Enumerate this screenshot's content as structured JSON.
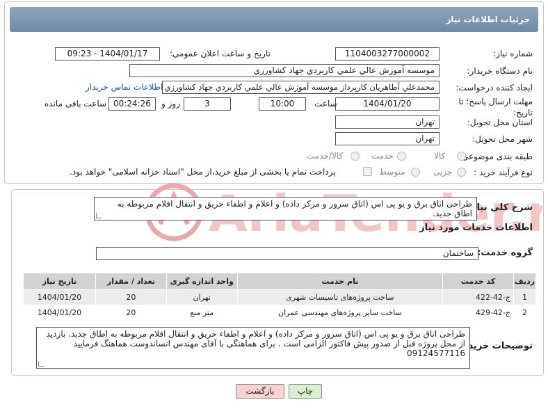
{
  "header": {
    "title": "جزئیات اطلاعات نیاز"
  },
  "fields": {
    "need_number_label": "شماره نیاز:",
    "need_number": "1104003277000002",
    "announce_label": "تاریخ و ساعت اعلان عمومی:",
    "announce_value": "1404/01/17 - 09:23",
    "buyer_org_label": "نام دستگاه خریدار:",
    "buyer_org": "موسسه آموزش عالي علمي کاربردي جهاد کشاورزي",
    "creator_label": "ایجاد کننده درخواست:",
    "creator": "محمدعلي آطاهريان کارپرداز موسسه آموزش عالي علمي کاربردي جهاد کشاورزي",
    "contact_link": "اطلاعات تماس خریدار",
    "deadline_label": "مهلت ارسال پاسخ: تا تاریخ:",
    "deadline_date": "1404/01/20",
    "time_label": "ساعت",
    "deadline_time": "10:00",
    "days_value": "3",
    "days_label": "روز و",
    "remaining_time": "00:24:26",
    "remaining_label": "ساعت باقی مانده",
    "province_label": "استان محل تحویل:",
    "province": "تهران",
    "city_label": "شهر محل تحویل:",
    "city": "تهران",
    "category_label": "طبقه بندی موضوعی:",
    "category_options": [
      "کالا",
      "خدمت",
      "کالا/خدمت"
    ],
    "process_label": "نوع فرآیند خرید :",
    "process_options": [
      "جزیی",
      "متوسط"
    ],
    "payment_note": "پرداخت تمام یا بخشی از مبلغ خرید،از محل \"اسناد خزانه اسلامی\" خواهد بود."
  },
  "summary": {
    "label": "شرح کلی نیاز:",
    "text": "طراحی اتاق برق و یو پی اس (اتاق سرور و مرکز داده) و اعلام و اطفاء حریق و انتقال اقلام مربوطه به اطاق جدید."
  },
  "services": {
    "title": "اطلاعات خدمات مورد نیاز",
    "group_label": "گروه خدمت:",
    "group_value": "ساختمان",
    "columns": [
      "ردیف",
      "کد خدمت",
      "نام خدمت",
      "واحد اندازه گیری",
      "تعداد / مقدار",
      "تاریخ نیاز"
    ],
    "rows": [
      {
        "idx": "1",
        "code": "ج-42-422",
        "name": "ساخت پروژه‌های تاسیسات شهری",
        "unit": "تهران",
        "qty": "20",
        "date": "1404/01/20"
      },
      {
        "idx": "2",
        "code": "ج-42-429",
        "name": "ساخت سایر پروژه‌های مهندسی عمران",
        "unit": "متر مبع",
        "qty": "20",
        "date": "1404/01/20"
      }
    ]
  },
  "buyer_notes": {
    "label": "توضیحات خریدار:",
    "text": "طراحی اتاق برق و یو پی اس (اتاق سرور و مرکز داده) و اعلام و اطفاء حریق و انتقال اقلام مربوطه به اطاق جدید. بازدید از محل پروژه قبل از صدور پیش فاکتور الزامی است . برای هماهنگی با آقای مهندس انساندوست هماهنگ فرمایید 09124577116"
  },
  "buttons": {
    "print": "چاپ",
    "back": "بازگشت"
  },
  "watermark": {
    "text": "AriaTender.neT"
  },
  "colors": {
    "header_bg": "#7d95ae",
    "link": "#1a56b0",
    "back_btn": "#f7d2d2",
    "print_btn": "#d8f0d0",
    "watermark": "#e7a9a9"
  }
}
